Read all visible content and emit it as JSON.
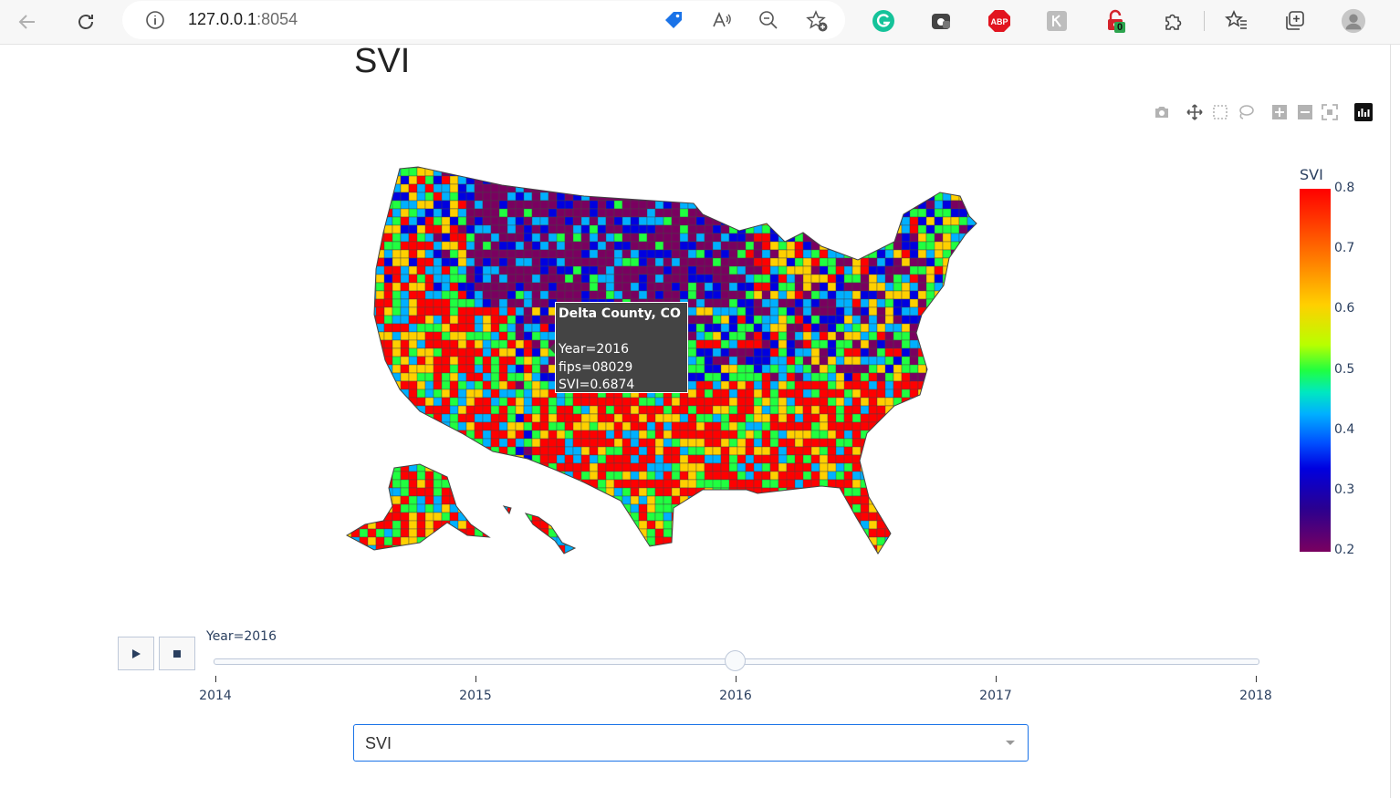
{
  "browser": {
    "url_host": "127.0.0.1",
    "url_port": ":8054",
    "extensions": [
      "grammarly-icon",
      "screenshot-extension-icon",
      "adblock-plus-icon",
      "extension-icon",
      "lock-extension-icon",
      "puzzle-icon"
    ],
    "lock_badge": "0",
    "abp_label": "ABP"
  },
  "page": {
    "title": "SVI"
  },
  "map": {
    "colorbar_title": "SVI",
    "colorbar_ticks": [
      "0.8",
      "0.7",
      "0.6",
      "0.5",
      "0.4",
      "0.3",
      "0.2"
    ],
    "colorscale": [
      "#7a0060",
      "#0000e0",
      "#00b0ff",
      "#20ff40",
      "#ffd000",
      "#ff0000"
    ],
    "border_color": "#444444"
  },
  "tooltip": {
    "name": "Delta County, CO",
    "year": "Year=2016",
    "fips": "fips=08029",
    "svi": "SVI=0.6874"
  },
  "slider": {
    "current_label": "Year=2016",
    "steps": [
      "2014",
      "2015",
      "2016",
      "2017",
      "2018"
    ],
    "active": "2016",
    "play_icon": "play-icon",
    "stop_icon": "stop-icon"
  },
  "dropdown": {
    "value": "SVI"
  }
}
